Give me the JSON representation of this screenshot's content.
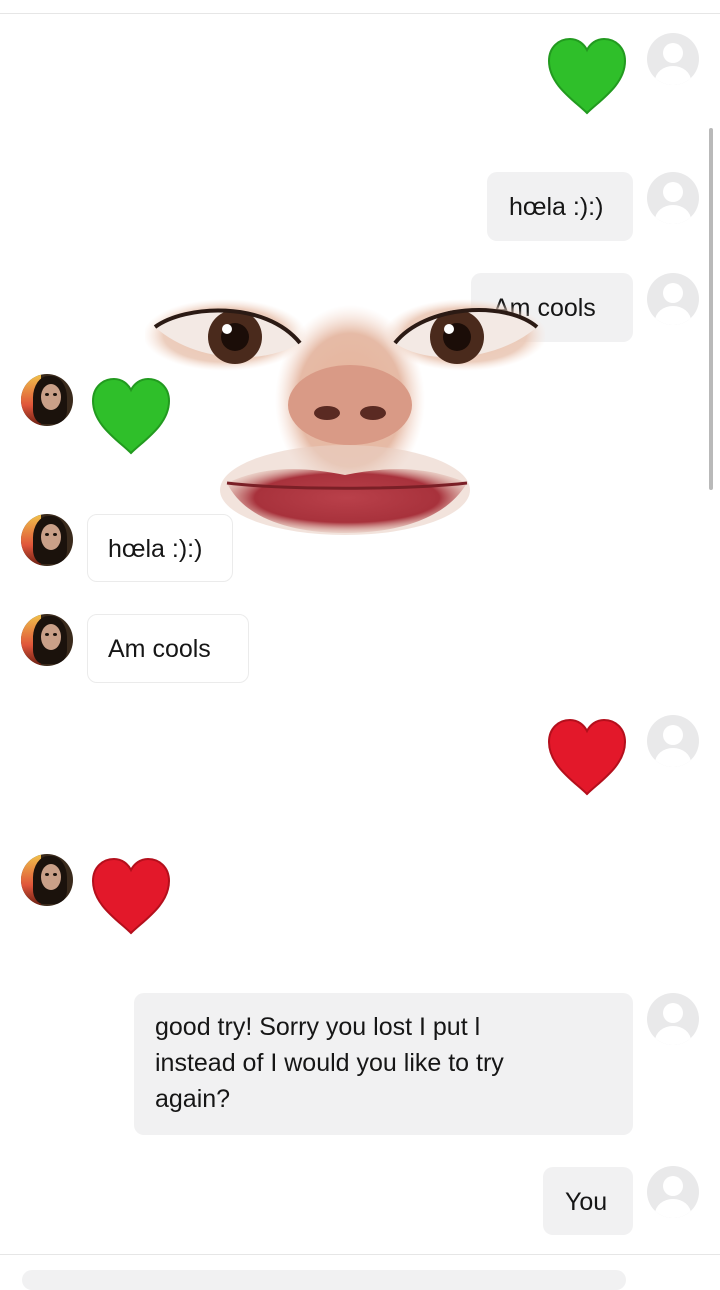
{
  "conversation": {
    "messages": [
      {
        "side": "right",
        "type": "emoji",
        "icon": "green-heart-icon",
        "color": "#2fbf2a"
      },
      {
        "side": "right",
        "type": "text",
        "text": "hœla :):)"
      },
      {
        "side": "right",
        "type": "text",
        "text": "Am cools"
      },
      {
        "side": "left",
        "type": "emoji",
        "icon": "green-heart-icon",
        "color": "#2fbf2a"
      },
      {
        "side": "left",
        "type": "text",
        "text": "hœla :):)"
      },
      {
        "side": "left",
        "type": "text",
        "text": "Am cools"
      },
      {
        "side": "right",
        "type": "emoji",
        "icon": "red-heart-icon",
        "color": "#e3182a"
      },
      {
        "side": "left",
        "type": "emoji",
        "icon": "red-heart-icon",
        "color": "#e3182a"
      },
      {
        "side": "right",
        "type": "text",
        "lines": [
          "good try! Sorry you lost I put l",
          "instead of I would you like to try",
          "again?"
        ]
      },
      {
        "side": "right",
        "type": "text",
        "text": "You"
      }
    ]
  },
  "overlay": {
    "icon": "face-sticker-icon"
  },
  "colors": {
    "bubble_right": "#f1f1f2",
    "bubble_left_border": "#ebebeb",
    "avatar_default": "#e9e9ea"
  }
}
